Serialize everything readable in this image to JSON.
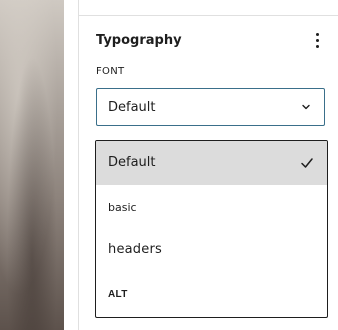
{
  "sidebar": {
    "section_title": "Typography",
    "options_icon": "more-vertical-icon",
    "font_field": {
      "label": "FONT",
      "selected_value": "Default",
      "chevron_icon": "chevron-down-icon"
    },
    "dropdown": {
      "check_icon": "check-icon",
      "options": [
        {
          "label": "Default",
          "selected": true
        },
        {
          "label": "basic",
          "selected": false
        },
        {
          "label": "headers",
          "selected": false
        },
        {
          "label": "ALT",
          "selected": false
        }
      ]
    }
  },
  "colors": {
    "focus_border": "#3a6f8a",
    "selected_bg": "#dcdcdc",
    "text": "#1e1e1e"
  }
}
